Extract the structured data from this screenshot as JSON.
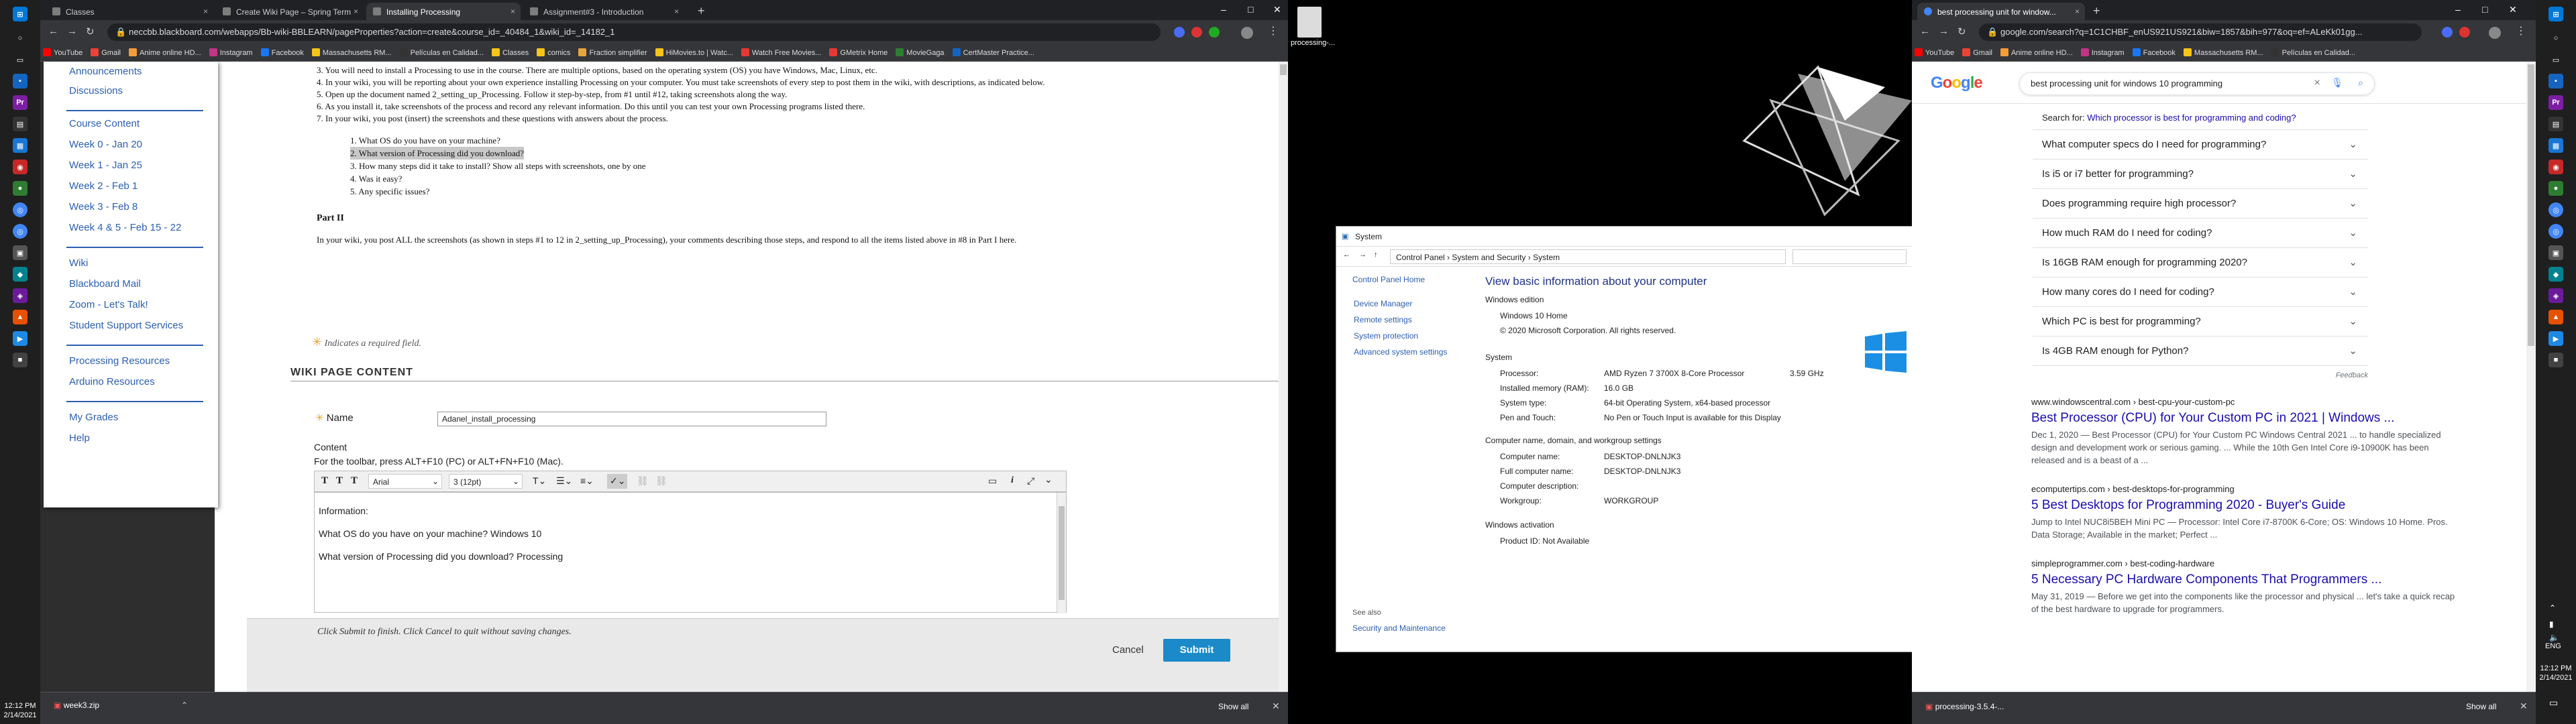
{
  "taskbar_left": {
    "time": "12:12 PM",
    "date": "2/14/2021"
  },
  "taskbar_right": {
    "time": "12:12 PM",
    "date": "2/14/2021",
    "lang": "ENG"
  },
  "left_browser": {
    "tabs": [
      {
        "label": "Classes"
      },
      {
        "label": "Create Wiki Page – Spring Term"
      },
      {
        "label": "Installing Processing"
      },
      {
        "label": "Assignment#3 - Introduction"
      }
    ],
    "url": "neccbb.blackboard.com/webapps/Bb-wiki-BBLEARN/pageProperties?action=create&course_id=_40484_1&wiki_id=_14182_1",
    "bookmarks": [
      "YouTube",
      "Gmail",
      "Anime online HD...",
      "Instagram",
      "Facebook",
      "Massachusetts RM...",
      "Películas en Calidad...",
      "Classes",
      "comics",
      "Fraction simplifier",
      "HiMovies.to | Watc...",
      "Watch Free Movies...",
      "GMetrix Home",
      "MovieGaga",
      "CertMaster Practice..."
    ],
    "sidebar": {
      "top": [
        "Announcements",
        "Discussions"
      ],
      "section": "Course Content",
      "weeks": [
        "Week 0 - Jan 20",
        "Week 1 - Jan 25",
        "Week 2 - Feb 1",
        "Week 3 - Feb 8",
        "Week 4 & 5 - Feb 15 - 22"
      ],
      "links1": [
        "Wiki",
        "Blackboard Mail",
        "Zoom - Let's Talk!",
        "Student Support Services"
      ],
      "links2": [
        "Processing Resources",
        "Arduino Resources"
      ],
      "links3": [
        "My Grades",
        "Help"
      ]
    },
    "steps": [
      "3.  You will need to install a Processing to use in the course. There are multiple options, based on the operating system (OS) you have Windows, Mac, Linux, etc.",
      "4.  In your wiki, you will be reporting about your own experience installing Processing on your computer. You must take screenshots of every step to post them in the wiki, with descriptions, as indicated below.",
      "5.  Open up the document named 2_setting_up_Processing. Follow it step-by-step, from #1 until #12, taking screenshots along the way.",
      "6.  As you install it, take screenshots of the process and record any relevant information. Do this until you can test your own Processing programs listed there.",
      "7.  In your wiki, you post (insert) the screenshots and these questions with answers about the process."
    ],
    "questions": [
      "1.  What OS do you have on your machine?",
      "2.  What version of Processing did you download?",
      "3.  How many steps did it take to install? Show all steps with screenshots, one by one",
      "4.  Was it easy?",
      "5.  Any specific issues?"
    ],
    "part2_title": "Part II",
    "part2_text": "In your wiki, you post ALL the screenshots (as shown in steps #1 to 12 in 2_setting_up_Processing), your comments describing those steps, and respond to all the items listed above in #8 in Part I here.",
    "required": "Indicates a required field.",
    "section_title": "WIKI PAGE CONTENT",
    "name_label": "Name",
    "name_value": "Adanel_install_processing",
    "content_label": "Content",
    "toolbar_hint": "For the toolbar, press ALT+F10 (PC) or ALT+FN+F10 (Mac).",
    "font": "Arial",
    "size": "3 (12pt)",
    "editor_lines": [
      "Information:",
      "What OS do you have on your machine? Windows 10",
      "What version of Processing did you download? Processing"
    ],
    "submit_hint": "Click Submit to finish. Click Cancel to quit without saving changes.",
    "cancel": "Cancel",
    "submit": "Submit",
    "download": "week3.zip",
    "show_all": "Show all"
  },
  "desktop": {
    "icon_label": "processing-..."
  },
  "system": {
    "title": "System",
    "breadcrumb": [
      "Control Panel",
      "System and Security",
      "System"
    ],
    "cp_home": "Control Panel Home",
    "left_links": [
      "Device Manager",
      "Remote settings",
      "System protection",
      "Advanced system settings"
    ],
    "heading": "View basic information about your computer",
    "edition_h": "Windows edition",
    "edition": "Windows 10 Home",
    "copyright": "© 2020 Microsoft Corporation. All rights reserved.",
    "system_h": "System",
    "rows": [
      [
        "Processor:",
        "AMD Ryzen 7 3700X 8-Core Processor",
        "3.59 GHz"
      ],
      [
        "Installed memory (RAM):",
        "16.0 GB",
        ""
      ],
      [
        "System type:",
        "64-bit Operating System, x64-based processor",
        ""
      ],
      [
        "Pen and Touch:",
        "No Pen or Touch Input is available for this Display",
        ""
      ]
    ],
    "name_h": "Computer name, domain, and workgroup settings",
    "name_rows": [
      [
        "Computer name:",
        "DESKTOP-DNLNJK3"
      ],
      [
        "Full computer name:",
        "DESKTOP-DNLNJK3"
      ],
      [
        "Computer description:",
        ""
      ],
      [
        "Workgroup:",
        "WORKGROUP"
      ]
    ],
    "act_h": "Windows activation",
    "act": "Product ID: Not Available",
    "see_also": "See also",
    "sec_maint": "Security and Maintenance"
  },
  "right_browser": {
    "tab": "best processing unit for window...",
    "url": "google.com/search?q=1C1CHBF_enUS921US921&biw=1857&bih=977&oq=ef=ALeKk01gg...",
    "bookmarks": [
      "YouTube",
      "Gmail",
      "Anime online HD...",
      "Instagram",
      "Facebook",
      "Massachusetts RM...",
      "Películas en Calidad..."
    ],
    "query": "best processing unit for windows 10 programming",
    "search_for_prefix": "Search for: ",
    "search_for": "Which processor is best for programming and coding?",
    "paa": [
      "What computer specs do I need for programming?",
      "Is i5 or i7 better for programming?",
      "Does programming require high processor?",
      "How much RAM do I need for coding?",
      "Is 16GB RAM enough for programming 2020?",
      "How many cores do I need for coding?",
      "Which PC is best for programming?",
      "Is 4GB RAM enough for Python?"
    ],
    "feedback": "Feedback",
    "results": [
      {
        "site": "www.windowscentral.com › best-cpu-your-custom-pc",
        "title": "Best Processor (CPU) for Your Custom PC in 2021 | Windows ...",
        "snip": "Dec 1, 2020 — Best Processor (CPU) for Your Custom PC Windows Central 2021 ... to handle specialized design and development work or serious gaming. ... While the 10th Gen Intel Core i9-10900K has been released and is a beast of a ..."
      },
      {
        "site": "ecomputertips.com › best-desktops-for-programming",
        "title": "5 Best Desktops for Programming 2020 - Buyer's Guide",
        "snip": "Jump to Intel NUC8i5BEH Mini PC — Processor: Intel Core i7-8700K 6-Core; OS: Windows 10 Home. Pros. Data Storage; Available in the market; Perfect ..."
      },
      {
        "site": "simpleprogrammer.com › best-coding-hardware",
        "title": "5 Necessary PC Hardware Components That Programmers ...",
        "snip": "May 31, 2019 — Before we get into the components like the processor and physical ... let's take a quick recap of the best hardware to upgrade for programmers."
      }
    ],
    "download": "processing-3.5.4-...",
    "show_all": "Show all"
  }
}
